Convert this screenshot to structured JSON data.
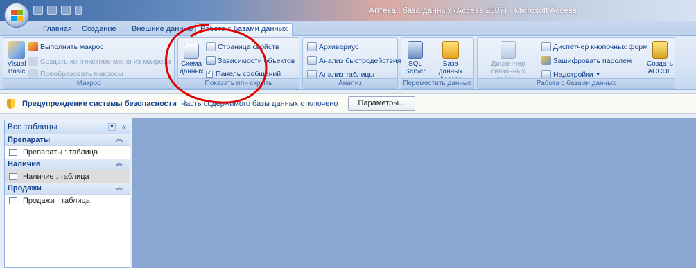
{
  "window": {
    "title": "Аптека : база данных (Access 2007) - Microsoft Access"
  },
  "tabs": [
    {
      "label": "Главная"
    },
    {
      "label": "Создание"
    },
    {
      "label": "Внешние данные"
    },
    {
      "label": "Работа с базами данных"
    }
  ],
  "ribbon": {
    "macro": {
      "group_label": "Макрос",
      "visual_basic": "Visual Basic",
      "run_macro": "Выполнить макрос",
      "create_context_menu": "Создать контекстное меню из макроса",
      "convert_macros": "Преобразовать макросы"
    },
    "show_hide": {
      "group_label": "Показать или скрыть",
      "schema": "Схема данных",
      "property_sheet": "Страница свойств",
      "object_dependencies": "Зависимости объектов",
      "message_bar": "Панель сообщений"
    },
    "analysis": {
      "group_label": "Анализ",
      "documenter": "Архивариус",
      "performance": "Анализ быстродействия",
      "table": "Анализ таблицы"
    },
    "move_data": {
      "group_label": "Переместить данные",
      "sql_server": "SQL Server",
      "access_db": "База данных Access"
    },
    "db_tools": {
      "group_label": "Работа с базами данных",
      "linked_table_manager": "Диспетчер связанных таблиц",
      "switchboard_manager": "Диспетчер кнопочных форм",
      "encrypt": "Зашифровать паролем",
      "addins": "Надстройки",
      "make_accde": "Создать ACCDE"
    }
  },
  "message_bar": {
    "warning_title": "Предупреждение системы безопасности",
    "warning_text": "Часть содержимого базы данных отключено",
    "options_button": "Параметры..."
  },
  "nav": {
    "header": "Все таблицы",
    "groups": [
      {
        "name": "Препараты",
        "item": "Препараты : таблица"
      },
      {
        "name": "Наличие",
        "item": "Наличие : таблица"
      },
      {
        "name": "Продажи",
        "item": "Продажи : таблица"
      }
    ]
  },
  "colors": {
    "accent": "#15428b",
    "workspace": "#8aa6d3",
    "annotation": "#e00000"
  }
}
